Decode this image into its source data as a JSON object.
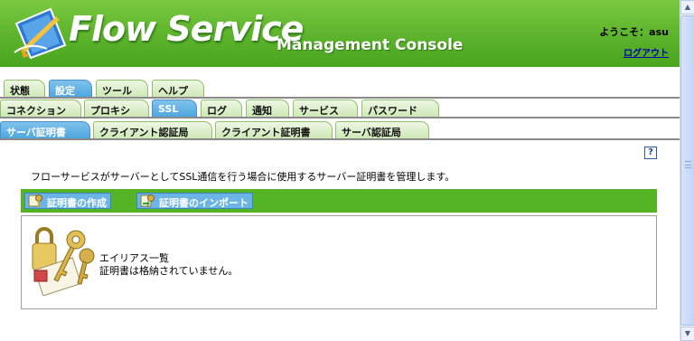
{
  "header": {
    "logo_main": "Flow Service",
    "logo_sub": "Management Console",
    "welcome": "ようこそ：asu",
    "logout": "ログアウト"
  },
  "tabs": {
    "row1": [
      {
        "label": "状態",
        "active": false
      },
      {
        "label": "設定",
        "active": true
      },
      {
        "label": "ツール",
        "active": false
      },
      {
        "label": "ヘルプ",
        "active": false
      }
    ],
    "row2": [
      {
        "label": "コネクション",
        "active": false
      },
      {
        "label": "プロキシ",
        "active": false
      },
      {
        "label": "SSL",
        "active": true
      },
      {
        "label": "ログ",
        "active": false
      },
      {
        "label": "通知",
        "active": false
      },
      {
        "label": "サービス",
        "active": false
      },
      {
        "label": "パスワード",
        "active": false
      }
    ],
    "row3": [
      {
        "label": "サーバ証明書",
        "active": true
      },
      {
        "label": "クライアント認証局",
        "active": false
      },
      {
        "label": "クライアント証明書",
        "active": false
      },
      {
        "label": "サーバ認証局",
        "active": false
      }
    ]
  },
  "help_icon_label": "?",
  "description": "フローサービスがサーバーとしてSSL通信を行う場合に使用するサーバー証明書を管理します。",
  "actions": {
    "create": "証明書の作成",
    "import": "証明書のインポート"
  },
  "panel": {
    "title": "エイリアス一覧",
    "message": "証明書は格納されていません。"
  },
  "colors": {
    "header_green": "#5cb32c",
    "active_tab_blue": "#4ea6de",
    "inactive_tab_green": "#cfe8b6",
    "action_bar_green": "#55b424"
  }
}
